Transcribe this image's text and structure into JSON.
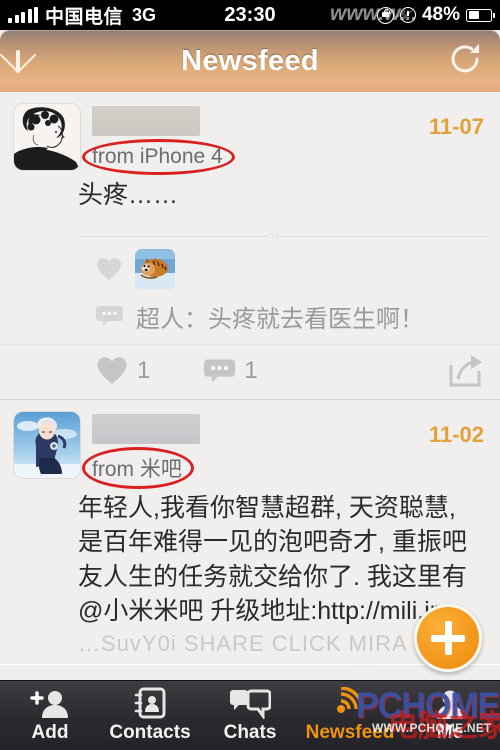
{
  "status_bar": {
    "carrier": "中国电信",
    "network": "3G",
    "time": "23:30",
    "battery_percent": "48%",
    "watermark": "www.w...",
    "icons": [
      "signal-bars-icon",
      "rotation-lock-icon",
      "alarm-clock-icon",
      "battery-icon"
    ]
  },
  "nav_bar": {
    "title": "Newsfeed",
    "left_icon": "envelope-icon",
    "right_icon": "refresh-icon"
  },
  "posts": [
    {
      "avatar": "sketch-woman-avatar",
      "username_redacted": true,
      "source": "from iPhone 4",
      "source_highlighted": true,
      "date": "11-07",
      "body": "头疼……",
      "likers": [
        {
          "thumb": "tiger-avatar"
        }
      ],
      "comment": "超人：头疼就去看医生啊！",
      "like_count": "1",
      "comment_count": "1",
      "share_icon": "share-icon"
    },
    {
      "avatar": "anime-boy-avatar",
      "username_redacted": true,
      "source": "from 米吧",
      "source_highlighted": true,
      "date": "11-02",
      "body_lines": [
        "年轻人,我看你智慧超群, 天资聪慧,",
        "是百年难得一见的泡吧奇才, 重振吧",
        "友人生的任务就交给你了. 我这里有",
        "@小米米吧 升级地址:http://mili.im"
      ],
      "body_cut_line": "…SuvY0i SHARE CLICK MIRA"
    }
  ],
  "fab": {
    "icon": "plus-icon",
    "label": "+"
  },
  "tab_bar": {
    "items": [
      {
        "label": "Add",
        "icon": "add-person-icon",
        "active": false
      },
      {
        "label": "Contacts",
        "icon": "contacts-card-icon",
        "active": false
      },
      {
        "label": "Chats",
        "icon": "chat-bubbles-icon",
        "active": false
      },
      {
        "label": "Newsfeed",
        "icon": "broadcast-icon",
        "active": true
      },
      {
        "label": "Me",
        "icon": "person-icon",
        "active": false
      }
    ]
  },
  "watermark": {
    "brand": "PCHOME",
    "url": "WWW.PCHOME.NET",
    "cn": "电脑之家"
  },
  "colors": {
    "accent_orange": "#e3a03b",
    "annotation_red": "#d9201f",
    "nav_tan": "#dba977",
    "tab_active": "#f0920f"
  }
}
